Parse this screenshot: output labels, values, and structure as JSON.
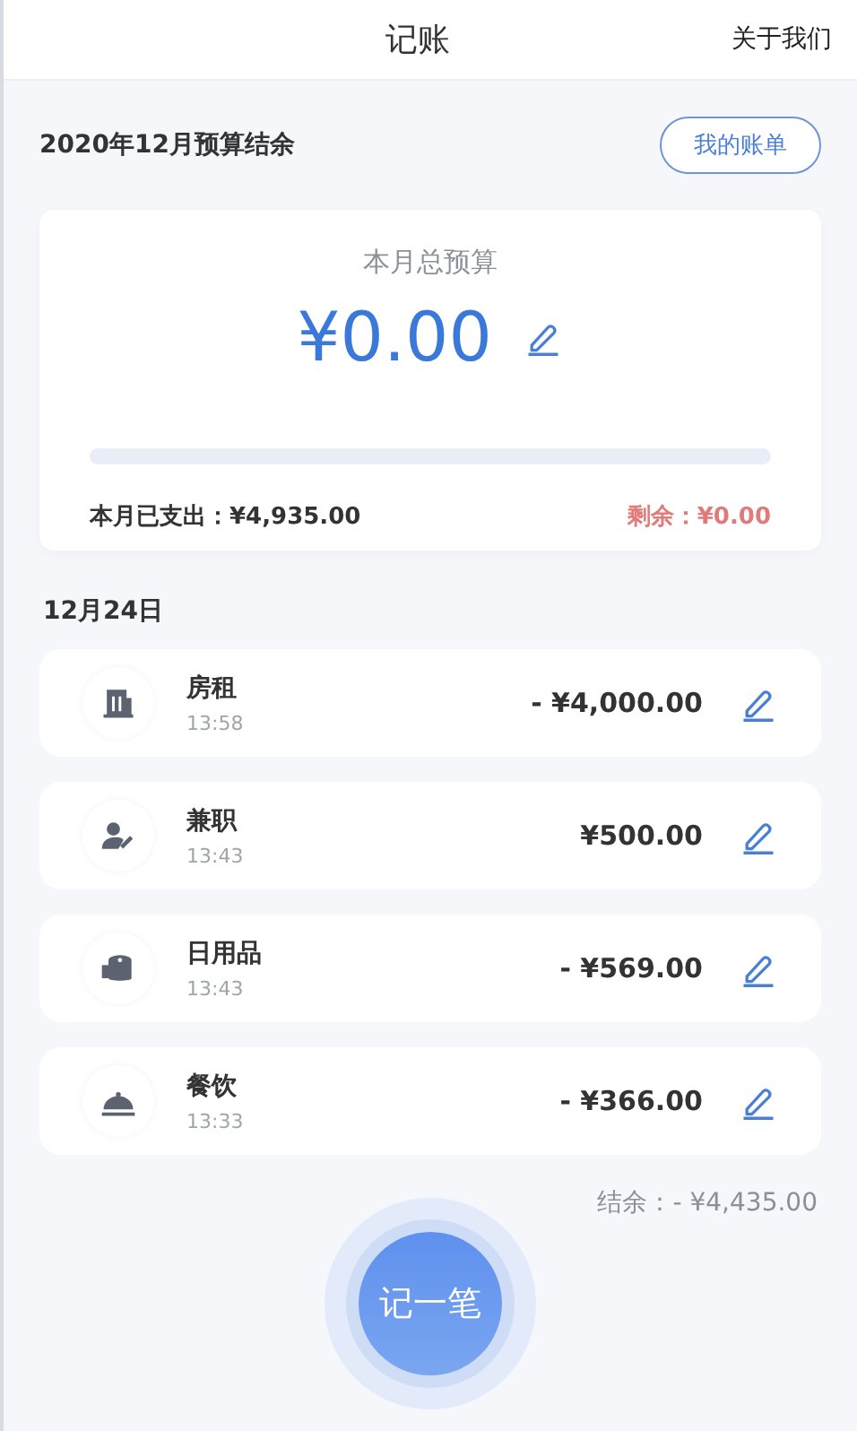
{
  "header": {
    "title": "记账",
    "about_link": "关于我们"
  },
  "budget_header": {
    "title": "2020年12月预算结余",
    "bills_button": "我的账单"
  },
  "budget_card": {
    "label": "本月总预算",
    "amount": "¥0.00",
    "level": 0,
    "spent": "本月已支出：¥4,935.00",
    "remaining": "剩余：¥0.00"
  },
  "day": {
    "date": "12月24日",
    "entries": [
      {
        "kind": "building",
        "name": "房租",
        "time": "13:58",
        "amount": "- ¥4,000.00"
      },
      {
        "kind": "person",
        "name": "兼职",
        "time": "13:43",
        "amount": "¥500.00"
      },
      {
        "kind": "roll",
        "name": "日用品",
        "time": "13:43",
        "amount": "- ¥569.00"
      },
      {
        "kind": "cloche",
        "name": "餐饮",
        "time": "13:33",
        "amount": "- ¥366.00"
      }
    ]
  },
  "balance": "结余：- ¥4,435.00",
  "add_button": "记一笔"
}
